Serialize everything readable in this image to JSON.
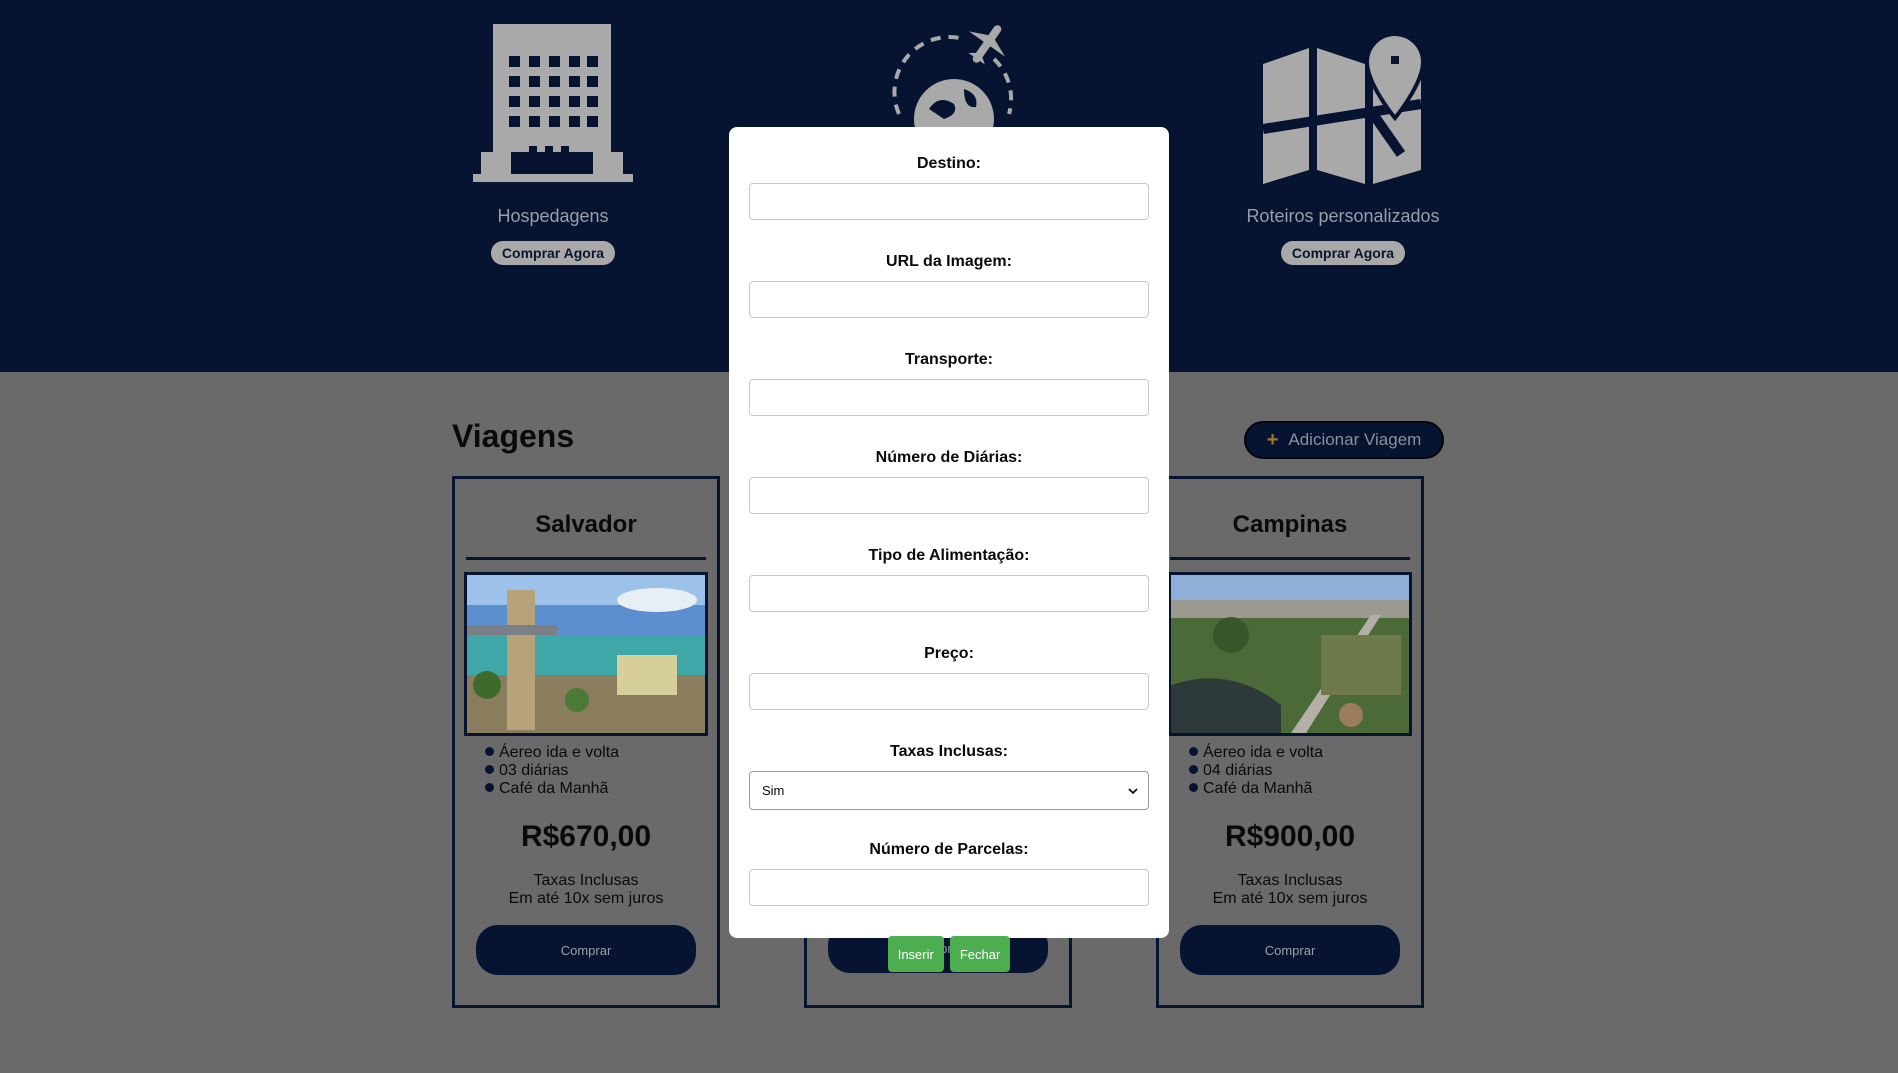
{
  "hero": {
    "items": [
      {
        "label": "Hospedagens",
        "button": "Comprar Agora"
      },
      {
        "label": "",
        "button": ""
      },
      {
        "label": "Roteiros personalizados",
        "button": "Comprar Agora"
      }
    ]
  },
  "section": {
    "title": "Viagens",
    "add_button": "Adicionar Viagem"
  },
  "cards": [
    {
      "destination": "Salvador",
      "features": [
        "Áereo ida e volta",
        "03 diárias",
        "Café da Manhã"
      ],
      "price": "R$670,00",
      "tax_line1": "Taxas Inclusas",
      "tax_line2": "Em até 10x sem juros",
      "buy": "Comprar"
    },
    {
      "destination": "",
      "features": [],
      "price": "",
      "tax_line1": "",
      "tax_line2": "",
      "buy": "Comprar"
    },
    {
      "destination": "Campinas",
      "features": [
        "Áereo ida e volta",
        "04 diárias",
        "Café da Manhã"
      ],
      "price": "R$900,00",
      "tax_line1": "Taxas Inclusas",
      "tax_line2": "Em até 10x sem juros",
      "buy": "Comprar"
    }
  ],
  "modal": {
    "fields": {
      "destino": "Destino:",
      "url": "URL da Imagem:",
      "transporte": "Transporte:",
      "diarias": "Número de Diárias:",
      "alimentacao": "Tipo de Alimentação:",
      "preco": "Preço:",
      "taxas": "Taxas Inclusas:",
      "parcelas": "Número de Parcelas:"
    },
    "taxas_selected": "Sim",
    "insert_button": "Inserir",
    "close_button": "Fechar"
  },
  "colors": {
    "navy": "#061331",
    "overlay_gray": "#6a6a6a",
    "green": "#4cae4f"
  }
}
